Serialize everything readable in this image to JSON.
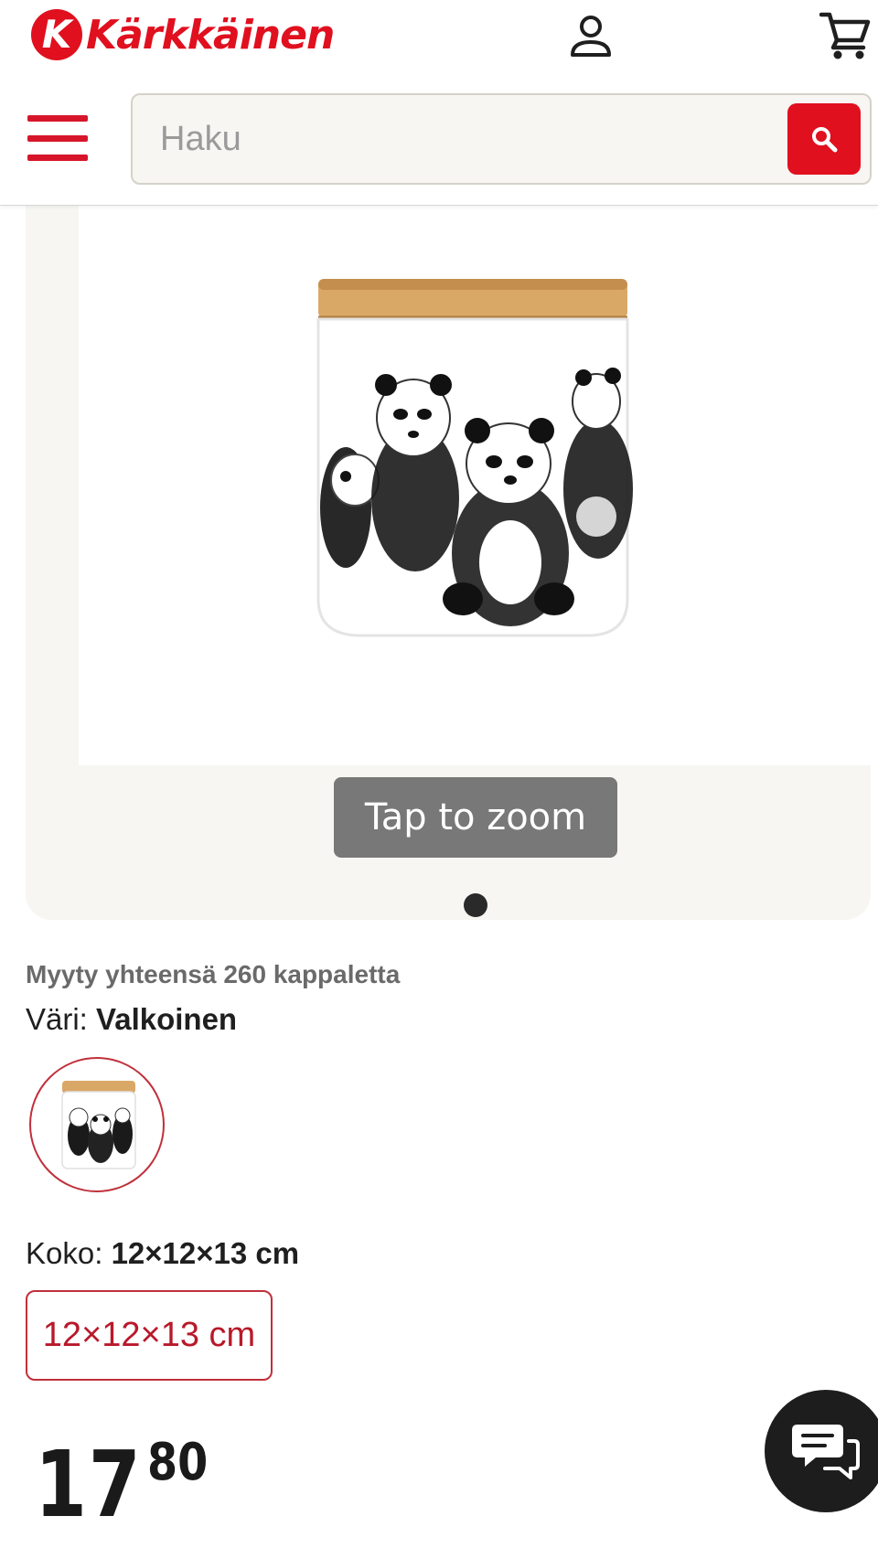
{
  "header": {
    "brand_initial": "K",
    "brand_name": "Kärkkäinen",
    "brand_color": "#e0101f",
    "icons": [
      "user-icon",
      "shopping-cart-icon",
      "menu-icon",
      "search-icon"
    ]
  },
  "search": {
    "placeholder": "Haku",
    "value": ""
  },
  "gallery": {
    "zoom_hint": "Tap to zoom",
    "image_count": 1,
    "current_image": 1
  },
  "product": {
    "sold_text": "Myyty yhteensä 260 kappaletta",
    "color_label": "Väri:",
    "color_value": "Valkoinen",
    "size_label": "Koko:",
    "size_value": "12×12×13 cm",
    "size_options": [
      "12×12×13 cm"
    ],
    "price_integer": "17",
    "price_decimal": "80"
  },
  "chat": {
    "icon": "chat-icon"
  }
}
